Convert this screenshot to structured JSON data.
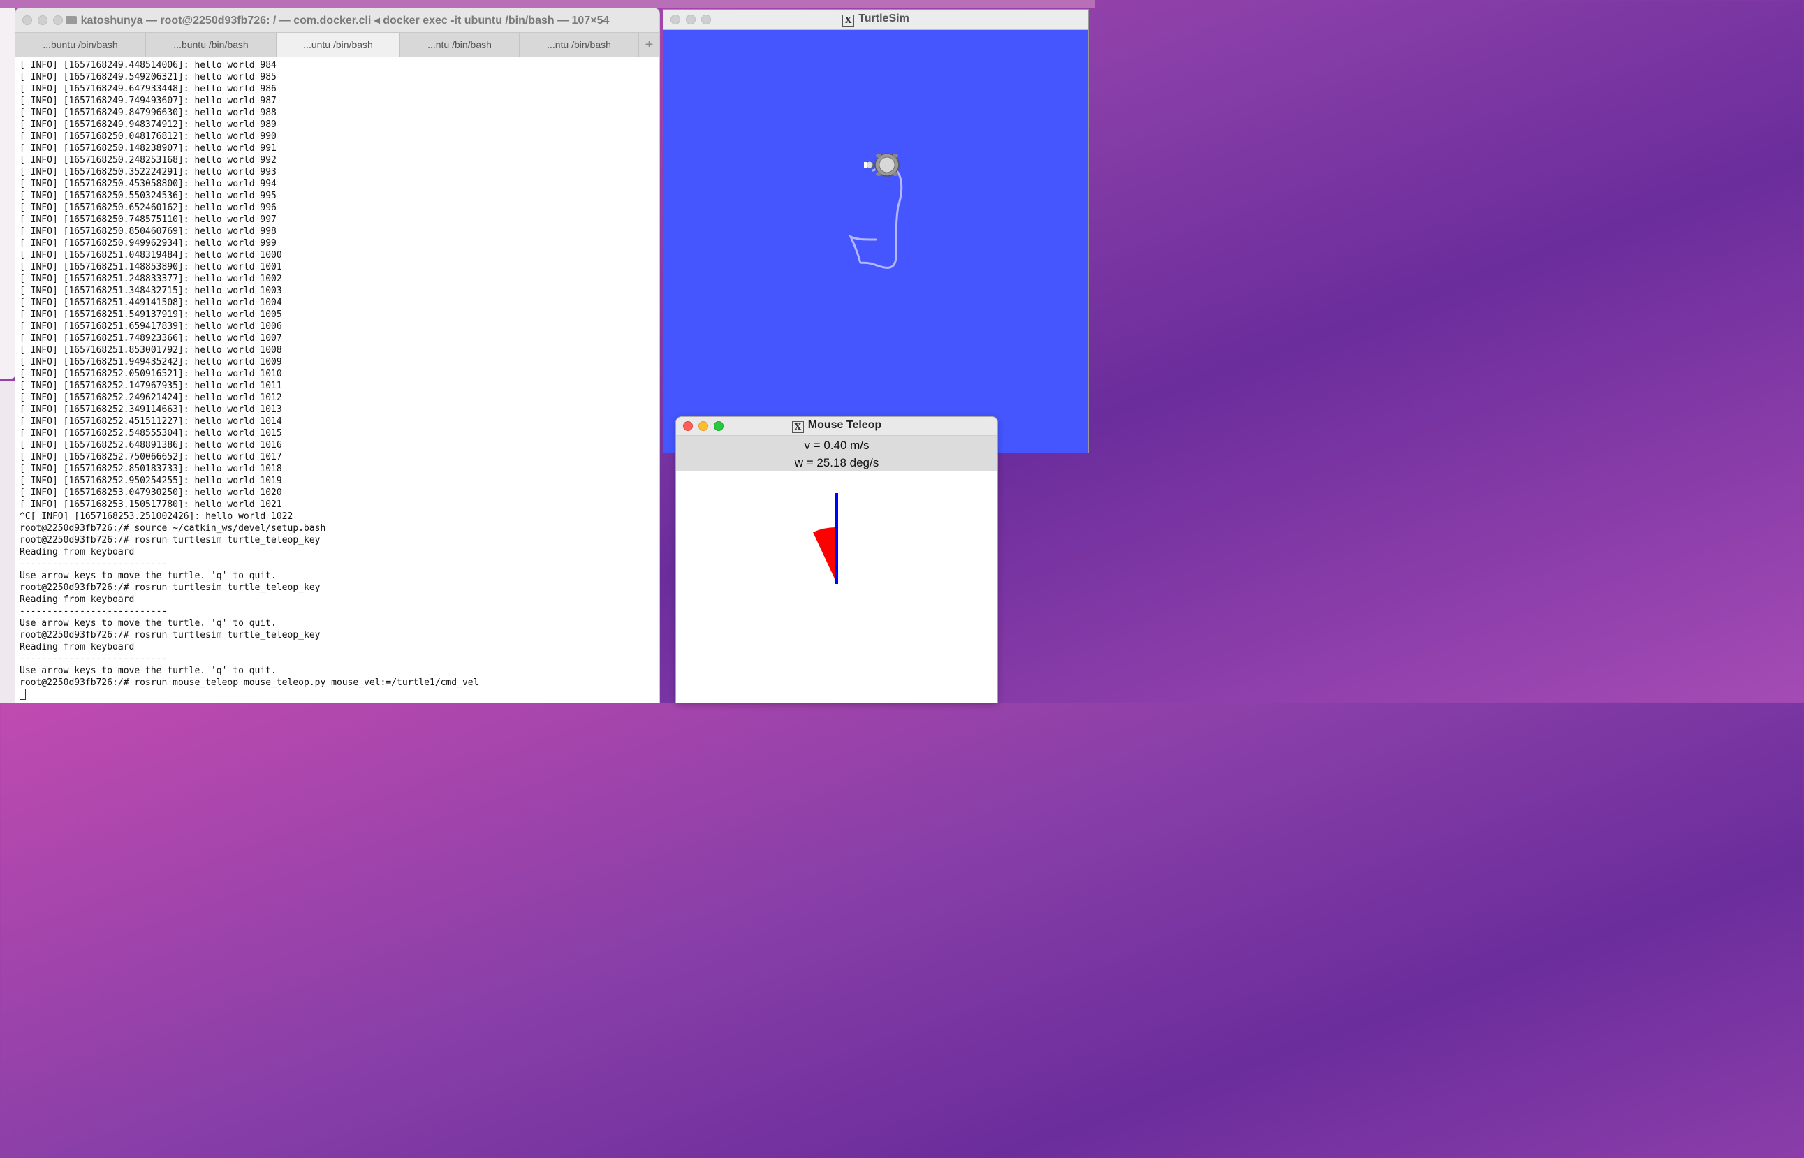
{
  "terminal": {
    "title": "katoshunya — root@2250d93fb726: / — com.docker.cli ◂ docker exec -it ubuntu /bin/bash — 107×54",
    "tabs": [
      {
        "label": "...buntu /bin/bash",
        "active": false
      },
      {
        "label": "...buntu /bin/bash",
        "active": false
      },
      {
        "label": "...untu /bin/bash",
        "active": true
      },
      {
        "label": "...ntu /bin/bash",
        "active": false
      },
      {
        "label": "...ntu /bin/bash",
        "active": false
      }
    ],
    "new_tab_label": "+",
    "lines": [
      "[ INFO] [1657168249.448514006]: hello world 984",
      "[ INFO] [1657168249.549206321]: hello world 985",
      "[ INFO] [1657168249.647933448]: hello world 986",
      "[ INFO] [1657168249.749493607]: hello world 987",
      "[ INFO] [1657168249.847996630]: hello world 988",
      "[ INFO] [1657168249.948374912]: hello world 989",
      "[ INFO] [1657168250.048176812]: hello world 990",
      "[ INFO] [1657168250.148238907]: hello world 991",
      "[ INFO] [1657168250.248253168]: hello world 992",
      "[ INFO] [1657168250.352224291]: hello world 993",
      "[ INFO] [1657168250.453058800]: hello world 994",
      "[ INFO] [1657168250.550324536]: hello world 995",
      "[ INFO] [1657168250.652460162]: hello world 996",
      "[ INFO] [1657168250.748575110]: hello world 997",
      "[ INFO] [1657168250.850460769]: hello world 998",
      "[ INFO] [1657168250.949962934]: hello world 999",
      "[ INFO] [1657168251.048319484]: hello world 1000",
      "[ INFO] [1657168251.148853890]: hello world 1001",
      "[ INFO] [1657168251.248833377]: hello world 1002",
      "[ INFO] [1657168251.348432715]: hello world 1003",
      "[ INFO] [1657168251.449141508]: hello world 1004",
      "[ INFO] [1657168251.549137919]: hello world 1005",
      "[ INFO] [1657168251.659417839]: hello world 1006",
      "[ INFO] [1657168251.748923366]: hello world 1007",
      "[ INFO] [1657168251.853001792]: hello world 1008",
      "[ INFO] [1657168251.949435242]: hello world 1009",
      "[ INFO] [1657168252.050916521]: hello world 1010",
      "[ INFO] [1657168252.147967935]: hello world 1011",
      "[ INFO] [1657168252.249621424]: hello world 1012",
      "[ INFO] [1657168252.349114663]: hello world 1013",
      "[ INFO] [1657168252.451511227]: hello world 1014",
      "[ INFO] [1657168252.548555304]: hello world 1015",
      "[ INFO] [1657168252.648891386]: hello world 1016",
      "[ INFO] [1657168252.750066652]: hello world 1017",
      "[ INFO] [1657168252.850183733]: hello world 1018",
      "[ INFO] [1657168252.950254255]: hello world 1019",
      "[ INFO] [1657168253.047930250]: hello world 1020",
      "[ INFO] [1657168253.150517780]: hello world 1021",
      "^C[ INFO] [1657168253.251002426]: hello world 1022",
      "root@2250d93fb726:/# source ~/catkin_ws/devel/setup.bash",
      "root@2250d93fb726:/# rosrun turtlesim turtle_teleop_key",
      "Reading from keyboard",
      "---------------------------",
      "Use arrow keys to move the turtle. 'q' to quit.",
      "root@2250d93fb726:/# rosrun turtlesim turtle_teleop_key",
      "Reading from keyboard",
      "---------------------------",
      "Use arrow keys to move the turtle. 'q' to quit.",
      "root@2250d93fb726:/# rosrun turtlesim turtle_teleop_key",
      "Reading from keyboard",
      "---------------------------",
      "Use arrow keys to move the turtle. 'q' to quit.",
      "root@2250d93fb726:/# rosrun mouse_teleop mouse_teleop.py mouse_vel:=/turtle1/cmd_vel"
    ]
  },
  "turtlesim": {
    "title": "TurtleSim",
    "background_color": "#4556ff",
    "trail_color": "#b3b8ff",
    "x_icon_text": "X"
  },
  "mouse_teleop": {
    "title": "Mouse Teleop",
    "x_icon_text": "X",
    "v_readout": "v = 0.40 m/s",
    "w_readout": "w = 25.18 deg/s",
    "v_color": "#0000ff",
    "w_color": "#ff0000"
  }
}
